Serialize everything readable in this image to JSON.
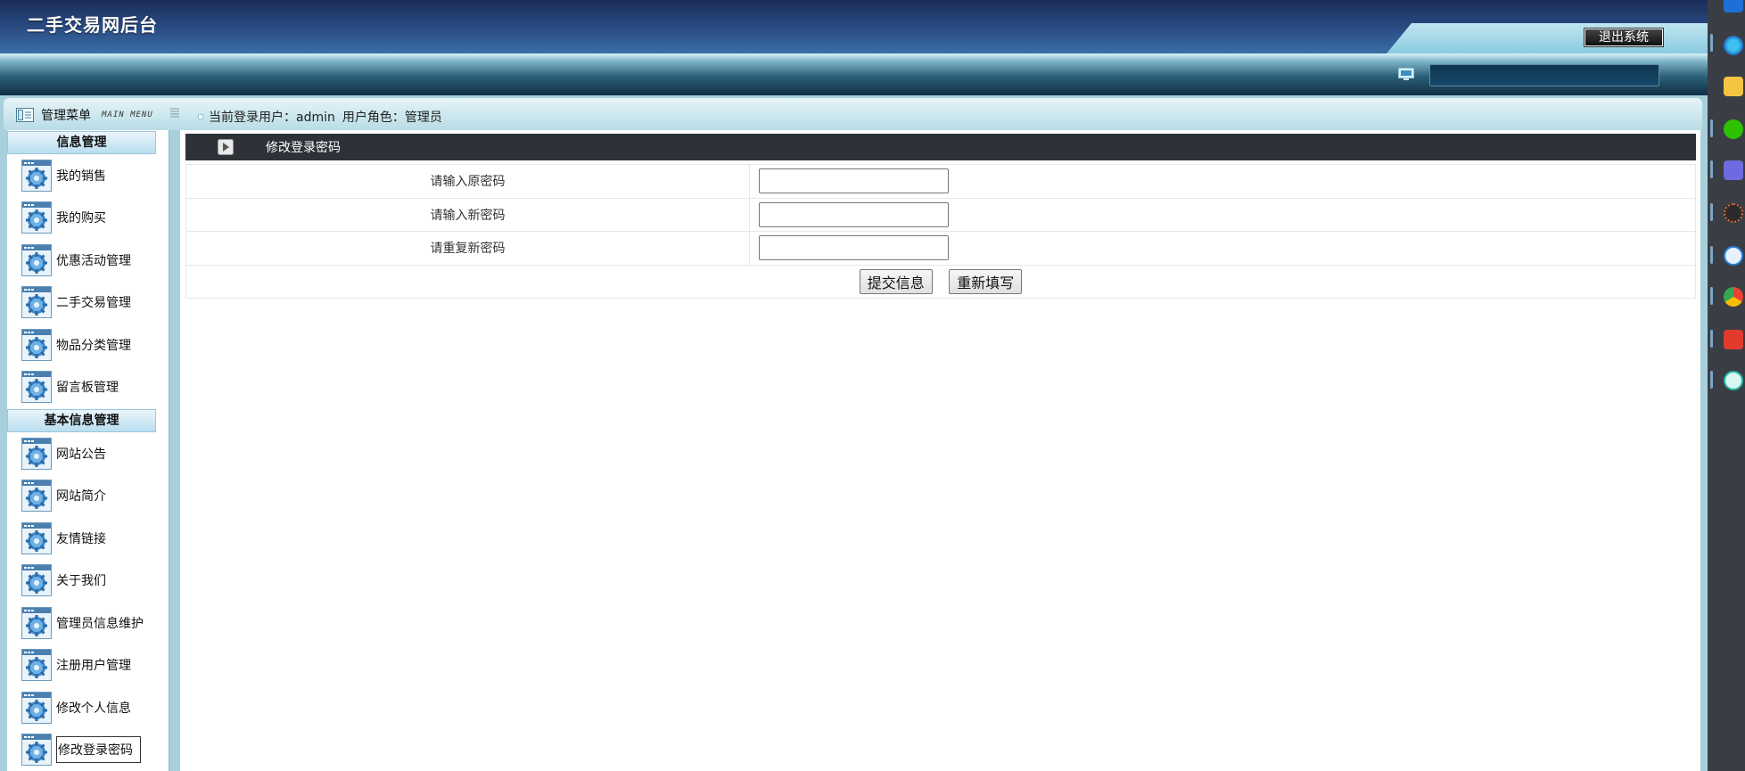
{
  "header": {
    "title": "二手交易网后台",
    "logout_label": "退出系统"
  },
  "menu": {
    "title": "管理菜单",
    "subtitle": "MAIN MENU"
  },
  "user_info": {
    "user_label": "当前登录用户：admin",
    "role_label": "用户角色：管理员"
  },
  "sidebar": {
    "sections": [
      {
        "title": "信息管理",
        "items": [
          "我的销售",
          "我的购买",
          "优惠活动管理",
          "二手交易管理",
          "物品分类管理",
          "留言板管理"
        ]
      },
      {
        "title": "基本信息管理",
        "items": [
          "网站公告",
          "网站简介",
          "友情链接",
          "关于我们",
          "管理员信息维护",
          "注册用户管理",
          "修改个人信息",
          "修改登录密码"
        ]
      }
    ],
    "active_item": "修改登录密码"
  },
  "panel": {
    "title": "修改登录密码",
    "fields": [
      {
        "label": "请输入原密码",
        "value": ""
      },
      {
        "label": "请输入新密码",
        "value": ""
      },
      {
        "label": "请重复新密码",
        "value": ""
      }
    ],
    "submit_label": "提交信息",
    "reset_label": "重新填写"
  },
  "colors": {
    "header_dark": "#1b2c58",
    "panel_head": "#2e3238",
    "page_bg": "#a8d0dc"
  },
  "icons": [
    "monitor-icon",
    "menu-icon",
    "gear-icon",
    "play-icon"
  ]
}
